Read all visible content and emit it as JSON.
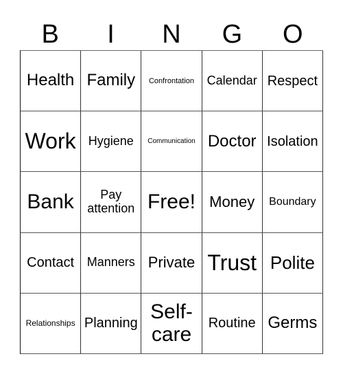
{
  "header": {
    "letters": [
      "B",
      "I",
      "N",
      "G",
      "O"
    ]
  },
  "cells": [
    "Health",
    "Family",
    "Confrontation",
    "Calendar",
    "Respect",
    "Work",
    "Hygiene",
    "Communication",
    "Doctor",
    "Isolation",
    "Bank",
    "Pay attention",
    "Free!",
    "Money",
    "Boundary",
    "Contact",
    "Manners",
    "Private",
    "Trust",
    "Polite",
    "Relationships",
    "Planning",
    "Self-care",
    "Routine",
    "Germs"
  ]
}
